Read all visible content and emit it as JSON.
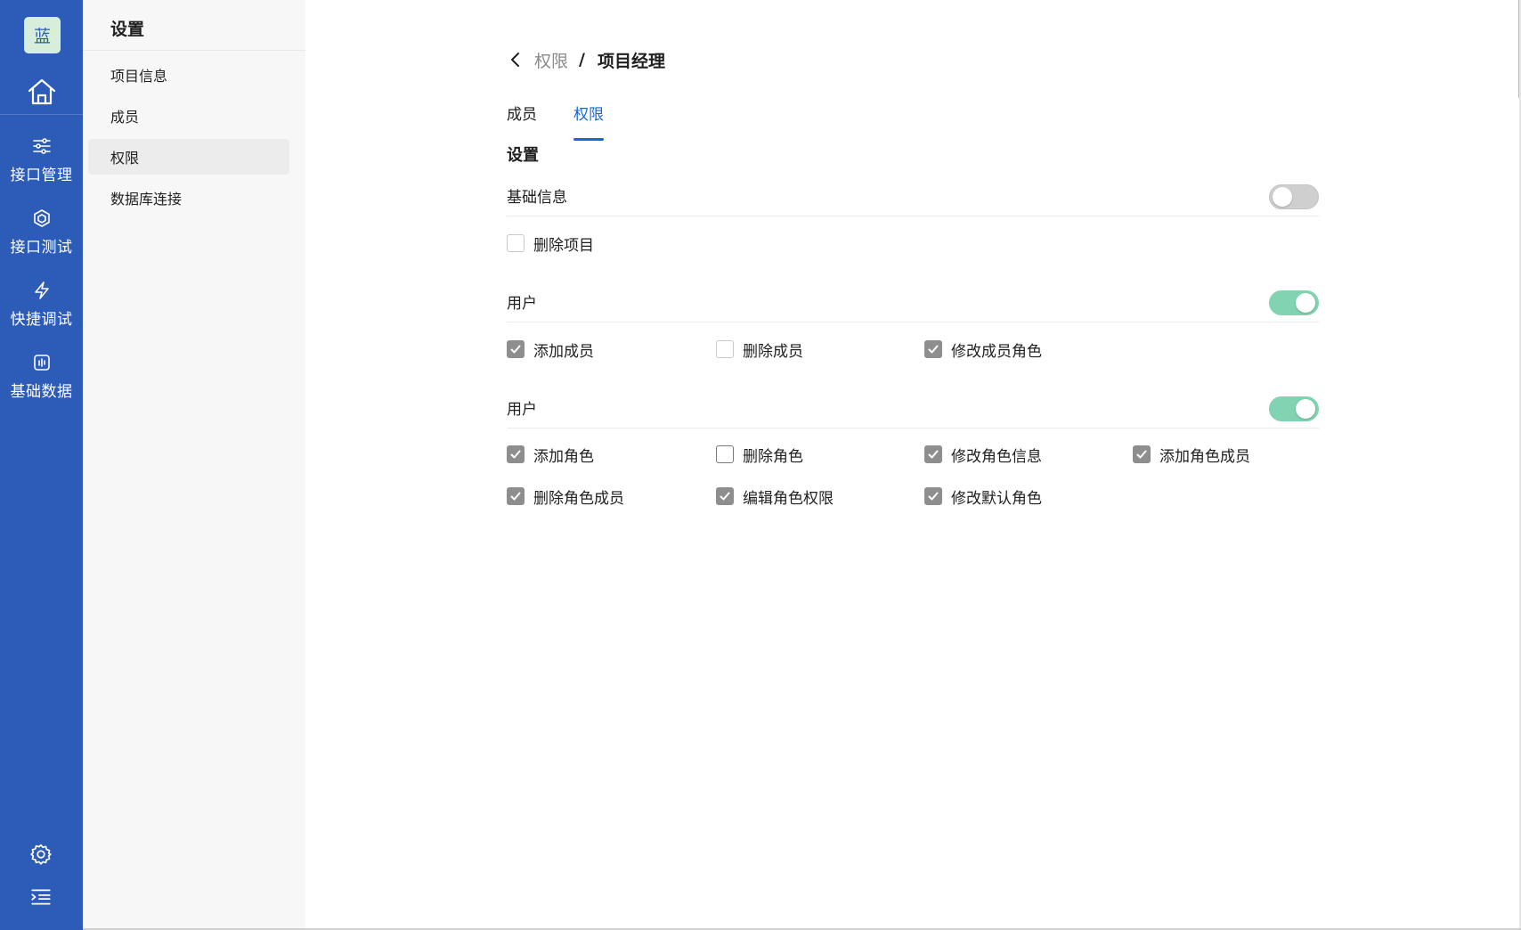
{
  "rail": {
    "logo_text": "蓝",
    "items": [
      {
        "label": "接口管理",
        "icon": "sliders-icon"
      },
      {
        "label": "接口测试",
        "icon": "cube-icon"
      },
      {
        "label": "快捷调试",
        "icon": "lightning-icon"
      },
      {
        "label": "基础数据",
        "icon": "chart-box-icon"
      }
    ],
    "bottom_icons": [
      "gear-icon",
      "menu-indent-icon"
    ],
    "bg_color": "#2d5cb8"
  },
  "sidebar": {
    "title": "设置",
    "items": [
      {
        "label": "项目信息",
        "active": false
      },
      {
        "label": "成员",
        "active": false
      },
      {
        "label": "权限",
        "active": true
      },
      {
        "label": "数据库连接",
        "active": false
      }
    ]
  },
  "breadcrumb": {
    "parent": "权限",
    "separator": "/",
    "current": "项目经理"
  },
  "tabs": [
    {
      "label": "成员",
      "active": false
    },
    {
      "label": "权限",
      "active": true
    }
  ],
  "section_title": "设置",
  "groups": [
    {
      "title": "基础信息",
      "enabled": false,
      "permissions": [
        {
          "label": "删除项目",
          "checked": false
        }
      ]
    },
    {
      "title": "用户",
      "enabled": true,
      "permissions": [
        {
          "label": "添加成员",
          "checked": true
        },
        {
          "label": "删除成员",
          "checked": false
        },
        {
          "label": "修改成员角色",
          "checked": true
        }
      ]
    },
    {
      "title": "用户",
      "enabled": true,
      "permissions": [
        {
          "label": "添加角色",
          "checked": true
        },
        {
          "label": "删除角色",
          "checked": false
        },
        {
          "label": "修改角色信息",
          "checked": true
        },
        {
          "label": "添加角色成员",
          "checked": true
        },
        {
          "label": "删除角色成员",
          "checked": true
        },
        {
          "label": "编辑角色权限",
          "checked": true
        },
        {
          "label": "修改默认角色",
          "checked": true
        }
      ]
    }
  ],
  "colors": {
    "accent": "#1a66d6",
    "toggle_on": "#82d3b2",
    "checkbox_checked": "#8e8e8e"
  }
}
